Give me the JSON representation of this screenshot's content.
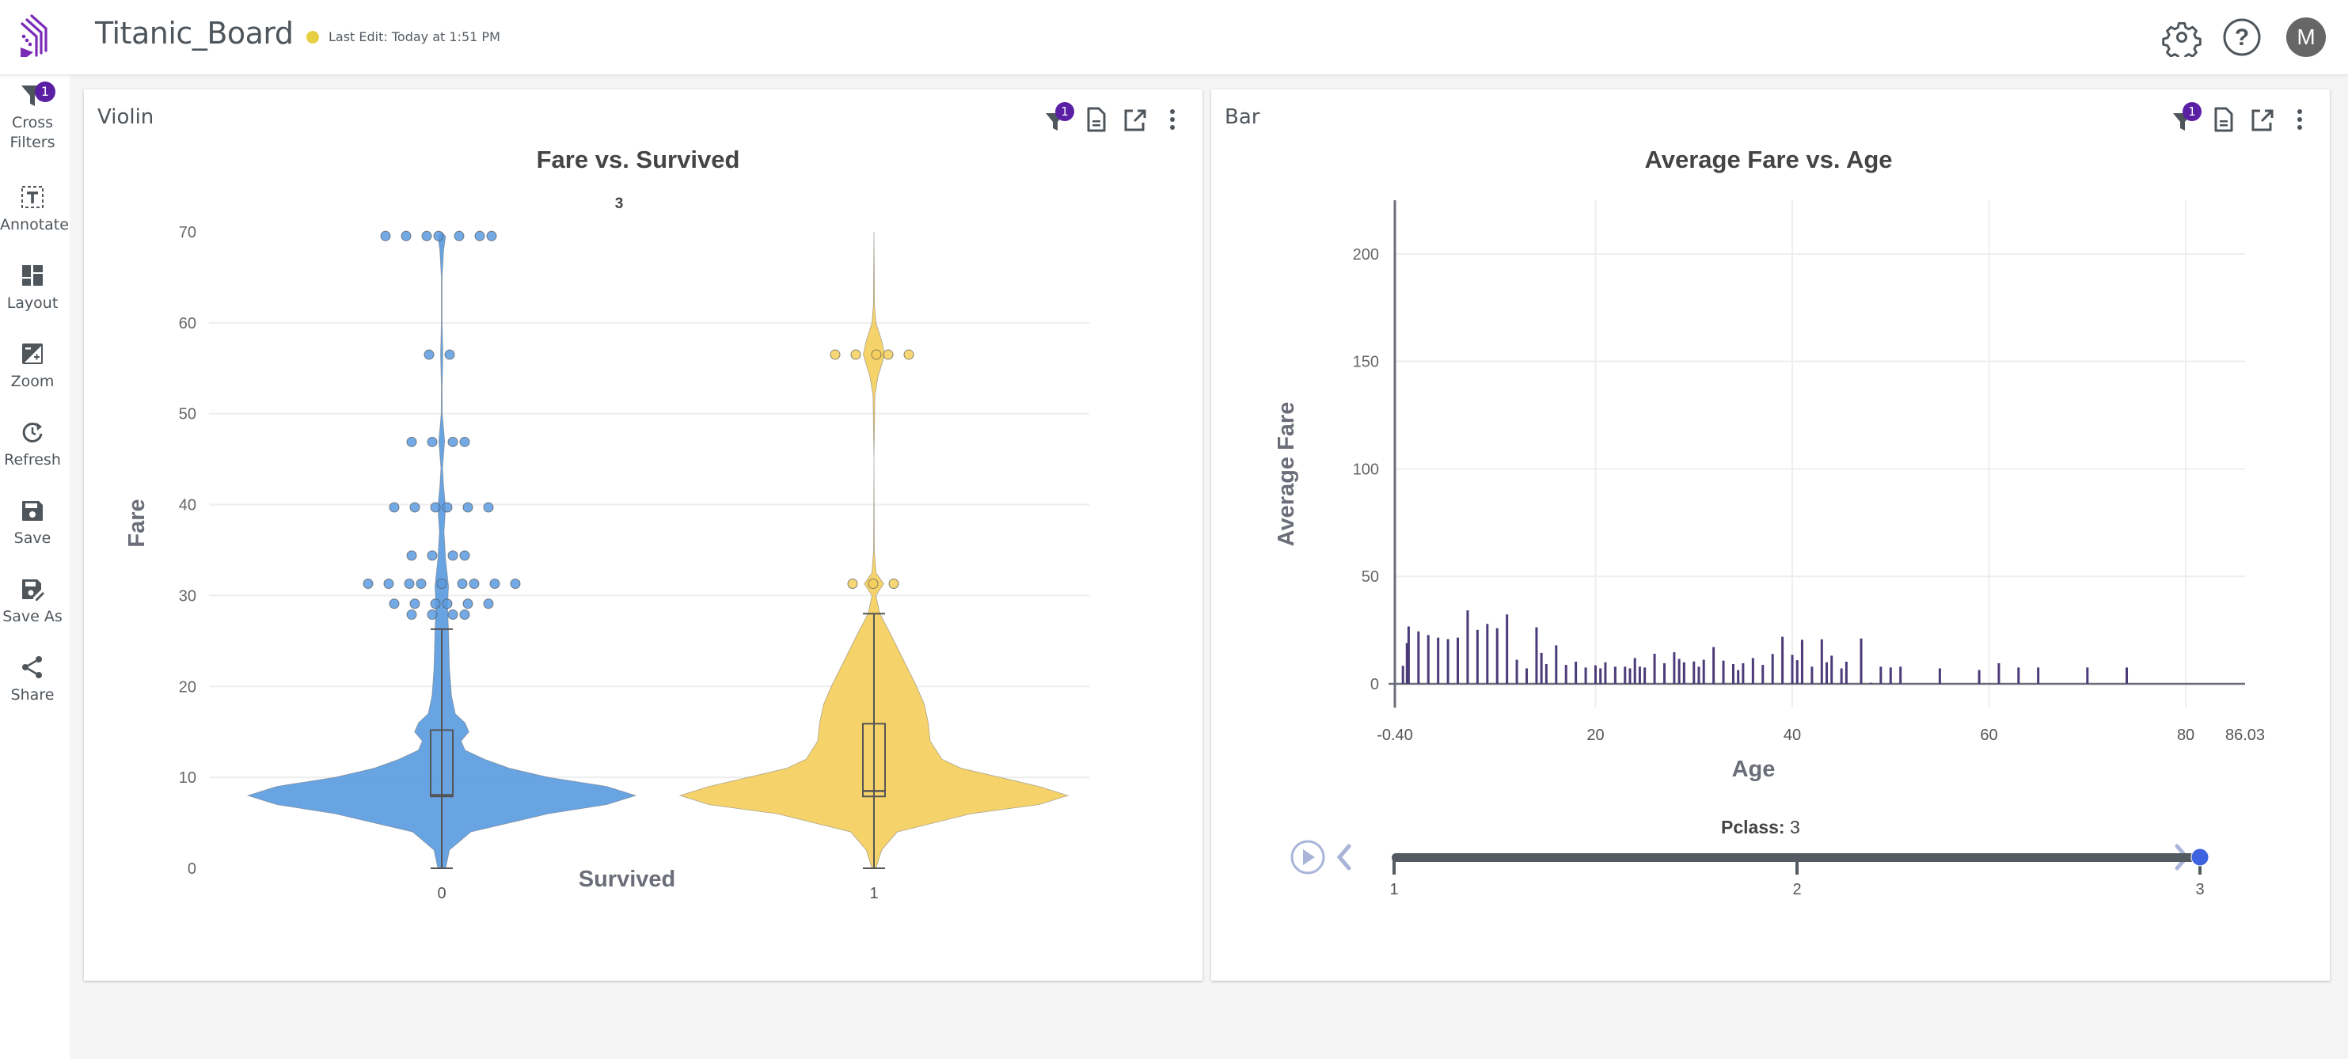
{
  "app": {
    "title": "Titanic_Board",
    "last_edit": "Last Edit: Today at 1:51 PM",
    "status_color": "#e7cf44",
    "brand_color": "#7b2cb7",
    "user_initial": "M",
    "header_icons": [
      "gear-icon",
      "help-icon"
    ]
  },
  "sidebar": {
    "items": [
      {
        "label": "Cross\nFilters",
        "line1": "Cross",
        "line2": "Filters",
        "icon": "filter-icon",
        "badge": "1"
      },
      {
        "label": "Annotate",
        "icon": "text-annotate-icon"
      },
      {
        "label": "Layout",
        "icon": "layout-icon"
      },
      {
        "label": "Zoom",
        "icon": "zoom-icon"
      },
      {
        "label": "Refresh",
        "icon": "refresh-icon"
      },
      {
        "label": "Save",
        "icon": "save-icon"
      },
      {
        "label": "Save As",
        "icon": "save-as-icon"
      },
      {
        "label": "Share",
        "icon": "share-icon"
      }
    ]
  },
  "panels": [
    {
      "title": "Violin",
      "filter_badge": "1",
      "tools": [
        "filter-icon",
        "document-icon",
        "open-external-icon",
        "more-vert-icon"
      ]
    },
    {
      "title": "Bar",
      "filter_badge": "1",
      "tools": [
        "filter-icon",
        "document-icon",
        "open-external-icon",
        "more-vert-icon"
      ]
    }
  ],
  "chart_data": [
    {
      "type": "violin",
      "title": "Fare vs. Survived",
      "subtitle": "3",
      "xlabel": "Survived",
      "ylabel": "Fare",
      "categories": [
        "0",
        "1"
      ],
      "ylim": [
        0,
        70
      ],
      "yticks": [
        0,
        10,
        20,
        30,
        40,
        50,
        60,
        70
      ],
      "grid": true,
      "series": [
        {
          "name": "0",
          "color": "#5b9be0",
          "box": {
            "min": 0,
            "q1": 7.9,
            "median": 8.05,
            "q3": 15.2,
            "upper_fence": 26.3
          },
          "density": [
            [
              0,
              0.02
            ],
            [
              2,
              0.04
            ],
            [
              4,
              0.15
            ],
            [
              6,
              0.55
            ],
            [
              7,
              0.85
            ],
            [
              8,
              1.0
            ],
            [
              9,
              0.85
            ],
            [
              10,
              0.55
            ],
            [
              11,
              0.35
            ],
            [
              12,
              0.22
            ],
            [
              13,
              0.12
            ],
            [
              14,
              0.1
            ],
            [
              15,
              0.14
            ],
            [
              16,
              0.12
            ],
            [
              17,
              0.07
            ],
            [
              19,
              0.05
            ],
            [
              22,
              0.04
            ],
            [
              26,
              0.035
            ],
            [
              29,
              0.03
            ],
            [
              31,
              0.035
            ],
            [
              34,
              0.02
            ],
            [
              37,
              0.012
            ],
            [
              39.7,
              0.02
            ],
            [
              42,
              0.01
            ],
            [
              44,
              0.004
            ],
            [
              47,
              0.015
            ],
            [
              50,
              0.003
            ],
            [
              53,
              0.002
            ],
            [
              56.5,
              0.006
            ],
            [
              60,
              0.002
            ],
            [
              65,
              0.002
            ],
            [
              68,
              0.01
            ],
            [
              69.5,
              0.02
            ],
            [
              70,
              0.0
            ]
          ],
          "outliers": [
            69.55,
            69.55,
            69.55,
            69.55,
            69.55,
            69.55,
            69.55,
            56.5,
            56.5,
            46.9,
            46.9,
            46.9,
            46.9,
            39.7,
            39.7,
            39.7,
            39.7,
            39.7,
            39.7,
            34.4,
            34.4,
            34.4,
            34.4,
            31.3,
            31.3,
            31.3,
            31.3,
            31.3,
            31.3,
            31.3,
            31.3,
            31.3,
            29.1,
            29.1,
            29.1,
            29.1,
            29.1,
            29.1,
            27.9,
            27.9,
            27.9,
            27.9
          ]
        },
        {
          "name": "1",
          "color": "#f5cf5d",
          "box": {
            "min": 0,
            "q1": 7.9,
            "median": 8.5,
            "q3": 15.9,
            "upper_fence": 28
          },
          "density": [
            [
              0,
              0.01
            ],
            [
              2,
              0.04
            ],
            [
              4,
              0.12
            ],
            [
              6,
              0.5
            ],
            [
              7,
              0.85
            ],
            [
              8,
              1.0
            ],
            [
              9,
              0.85
            ],
            [
              10,
              0.65
            ],
            [
              11,
              0.45
            ],
            [
              12,
              0.35
            ],
            [
              14,
              0.29
            ],
            [
              16,
              0.28
            ],
            [
              18,
              0.26
            ],
            [
              20,
              0.22
            ],
            [
              23,
              0.15
            ],
            [
              26,
              0.08
            ],
            [
              28,
              0.03
            ],
            [
              30,
              0.01
            ],
            [
              31.3,
              0.05
            ],
            [
              32.5,
              0.01
            ],
            [
              35,
              0.002
            ],
            [
              45,
              0.0
            ],
            [
              52,
              0.005
            ],
            [
              54,
              0.02
            ],
            [
              56.5,
              0.055
            ],
            [
              58,
              0.04
            ],
            [
              60,
              0.01
            ],
            [
              62,
              0.003
            ],
            [
              70,
              0.0
            ]
          ],
          "outliers": [
            56.5,
            56.5,
            56.5,
            56.5,
            56.5,
            31.3,
            31.3,
            31.3
          ]
        }
      ]
    },
    {
      "type": "bar",
      "title": "Average Fare vs. Age",
      "xlabel": "Age",
      "ylabel": "Average Fare",
      "xlim": [
        -0.4,
        86.03
      ],
      "ylim": [
        0,
        225
      ],
      "xticks": [
        "-0.40",
        "20",
        "40",
        "60",
        "80",
        "86.03"
      ],
      "xtick_values": [
        -0.4,
        20,
        40,
        60,
        80,
        86.03
      ],
      "yticks": [
        0,
        50,
        100,
        150,
        200
      ],
      "grid": true,
      "color": "#4b3b78",
      "x": [
        0.42,
        0.83,
        1,
        2,
        3,
        4,
        5,
        6,
        7,
        8,
        9,
        10,
        11,
        12,
        13,
        14,
        14.5,
        15,
        16,
        17,
        18,
        19,
        20,
        20.5,
        21,
        22,
        23,
        23.5,
        24,
        24.5,
        25,
        26,
        27,
        28,
        28.5,
        29,
        30,
        30.5,
        31,
        32,
        33,
        34,
        34.5,
        35,
        36,
        37,
        38,
        39,
        40,
        40.5,
        41,
        42,
        43,
        43.5,
        44,
        45,
        45.5,
        47,
        48,
        49,
        50,
        51,
        55,
        59,
        61,
        63,
        65,
        70,
        74
      ],
      "values": [
        8.4,
        19,
        26.7,
        24.4,
        22.7,
        21.5,
        20.8,
        21.5,
        34.2,
        25.1,
        27.9,
        25.9,
        32.3,
        11.2,
        7.2,
        26.3,
        14.4,
        9.2,
        17.9,
        8.8,
        10.3,
        7.6,
        8.6,
        7.2,
        10,
        8,
        8,
        7.2,
        12,
        8,
        7.6,
        14,
        9.6,
        14.7,
        11.6,
        10,
        10.4,
        8,
        11.2,
        17.1,
        10.8,
        9.2,
        6.4,
        9.6,
        12,
        8.8,
        13.9,
        21.9,
        13.5,
        11,
        20.5,
        8,
        20.7,
        10,
        13.1,
        7.2,
        10.3,
        21.1,
        0.5,
        8,
        7.6,
        8,
        7.2,
        6.4,
        9.6,
        7.6,
        7.6,
        7.6,
        7.6
      ]
    }
  ],
  "slider": {
    "label": "Pclass:",
    "value": "3",
    "ticks": [
      "1",
      "2",
      "3"
    ],
    "current_fraction": 1.0,
    "play_icon": "play-icon",
    "prev_icon": "chevron-left-icon",
    "next_icon": "chevron-right-icon"
  }
}
